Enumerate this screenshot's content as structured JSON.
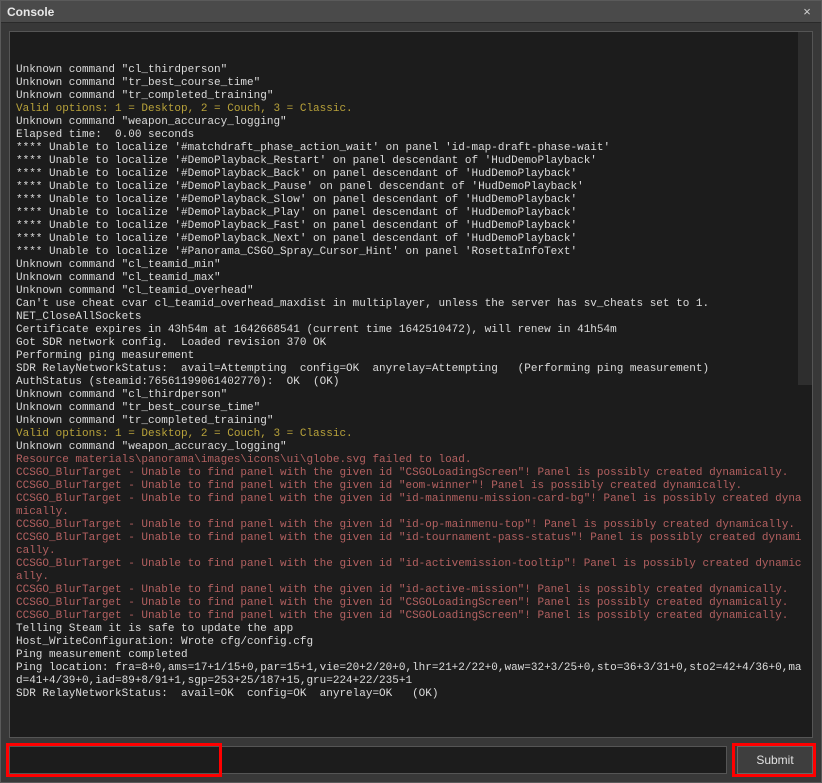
{
  "title": "Console",
  "submit_label": "Submit",
  "input_value": "",
  "log_lines": [
    {
      "t": "Unknown command \"cl_thirdperson\"",
      "c": "gray"
    },
    {
      "t": "Unknown command \"tr_best_course_time\"",
      "c": "gray"
    },
    {
      "t": "Unknown command \"tr_completed_training\"",
      "c": "gray"
    },
    {
      "t": "Valid options: 1 = Desktop, 2 = Couch, 3 = Classic.",
      "c": "yellow"
    },
    {
      "t": "Unknown command \"weapon_accuracy_logging\"",
      "c": "gray"
    },
    {
      "t": "Elapsed time:  0.00 seconds",
      "c": "gray"
    },
    {
      "t": "**** Unable to localize '#matchdraft_phase_action_wait' on panel 'id-map-draft-phase-wait'",
      "c": "gray"
    },
    {
      "t": "**** Unable to localize '#DemoPlayback_Restart' on panel descendant of 'HudDemoPlayback'",
      "c": "gray"
    },
    {
      "t": "**** Unable to localize '#DemoPlayback_Back' on panel descendant of 'HudDemoPlayback'",
      "c": "gray"
    },
    {
      "t": "**** Unable to localize '#DemoPlayback_Pause' on panel descendant of 'HudDemoPlayback'",
      "c": "gray"
    },
    {
      "t": "**** Unable to localize '#DemoPlayback_Slow' on panel descendant of 'HudDemoPlayback'",
      "c": "gray"
    },
    {
      "t": "**** Unable to localize '#DemoPlayback_Play' on panel descendant of 'HudDemoPlayback'",
      "c": "gray"
    },
    {
      "t": "**** Unable to localize '#DemoPlayback_Fast' on panel descendant of 'HudDemoPlayback'",
      "c": "gray"
    },
    {
      "t": "**** Unable to localize '#DemoPlayback_Next' on panel descendant of 'HudDemoPlayback'",
      "c": "gray"
    },
    {
      "t": "**** Unable to localize '#Panorama_CSGO_Spray_Cursor_Hint' on panel 'RosettaInfoText'",
      "c": "gray"
    },
    {
      "t": "Unknown command \"cl_teamid_min\"",
      "c": "gray"
    },
    {
      "t": "Unknown command \"cl_teamid_max\"",
      "c": "gray"
    },
    {
      "t": "Unknown command \"cl_teamid_overhead\"",
      "c": "gray"
    },
    {
      "t": "Can't use cheat cvar cl_teamid_overhead_maxdist in multiplayer, unless the server has sv_cheats set to 1.",
      "c": "gray"
    },
    {
      "t": "NET_CloseAllSockets",
      "c": "gray"
    },
    {
      "t": "Certificate expires in 43h54m at 1642668541 (current time 1642510472), will renew in 41h54m",
      "c": "gray"
    },
    {
      "t": "Got SDR network config.  Loaded revision 370 OK",
      "c": "gray"
    },
    {
      "t": "Performing ping measurement",
      "c": "gray"
    },
    {
      "t": "SDR RelayNetworkStatus:  avail=Attempting  config=OK  anyrelay=Attempting   (Performing ping measurement)",
      "c": "gray"
    },
    {
      "t": "AuthStatus (steamid:76561199061402770):  OK  (OK)",
      "c": "gray"
    },
    {
      "t": "Unknown command \"cl_thirdperson\"",
      "c": "gray"
    },
    {
      "t": "Unknown command \"tr_best_course_time\"",
      "c": "gray"
    },
    {
      "t": "Unknown command \"tr_completed_training\"",
      "c": "gray"
    },
    {
      "t": "Valid options: 1 = Desktop, 2 = Couch, 3 = Classic.",
      "c": "yellow"
    },
    {
      "t": "Unknown command \"weapon_accuracy_logging\"",
      "c": "gray"
    },
    {
      "t": "Resource materials\\panorama\\images\\icons\\ui\\globe.svg failed to load.",
      "c": "red"
    },
    {
      "t": "CCSGO_BlurTarget - Unable to find panel with the given id \"CSGOLoadingScreen\"! Panel is possibly created dynamically.",
      "c": "red"
    },
    {
      "t": "CCSGO_BlurTarget - Unable to find panel with the given id \"eom-winner\"! Panel is possibly created dynamically.",
      "c": "red"
    },
    {
      "t": "CCSGO_BlurTarget - Unable to find panel with the given id \"id-mainmenu-mission-card-bg\"! Panel is possibly created dynamically.",
      "c": "red"
    },
    {
      "t": "CCSGO_BlurTarget - Unable to find panel with the given id \"id-op-mainmenu-top\"! Panel is possibly created dynamically.",
      "c": "red"
    },
    {
      "t": "CCSGO_BlurTarget - Unable to find panel with the given id \"id-tournament-pass-status\"! Panel is possibly created dynamically.",
      "c": "red"
    },
    {
      "t": "CCSGO_BlurTarget - Unable to find panel with the given id \"id-activemission-tooltip\"! Panel is possibly created dynamically.",
      "c": "red"
    },
    {
      "t": "CCSGO_BlurTarget - Unable to find panel with the given id \"id-active-mission\"! Panel is possibly created dynamically.",
      "c": "red"
    },
    {
      "t": "CCSGO_BlurTarget - Unable to find panel with the given id \"CSGOLoadingScreen\"! Panel is possibly created dynamically.",
      "c": "red"
    },
    {
      "t": "CCSGO_BlurTarget - Unable to find panel with the given id \"CSGOLoadingScreen\"! Panel is possibly created dynamically.",
      "c": "red"
    },
    {
      "t": "Telling Steam it is safe to update the app",
      "c": "gray"
    },
    {
      "t": "Host_WriteConfiguration: Wrote cfg/config.cfg",
      "c": "gray"
    },
    {
      "t": "Ping measurement completed",
      "c": "gray"
    },
    {
      "t": "Ping location: fra=8+0,ams=17+1/15+0,par=15+1,vie=20+2/20+0,lhr=21+2/22+0,waw=32+3/25+0,sto=36+3/31+0,sto2=42+4/36+0,mad=41+4/39+0,iad=89+8/91+1,sgp=253+25/187+15,gru=224+22/235+1",
      "c": "gray"
    },
    {
      "t": "SDR RelayNetworkStatus:  avail=OK  config=OK  anyrelay=OK   (OK)",
      "c": "gray"
    }
  ]
}
